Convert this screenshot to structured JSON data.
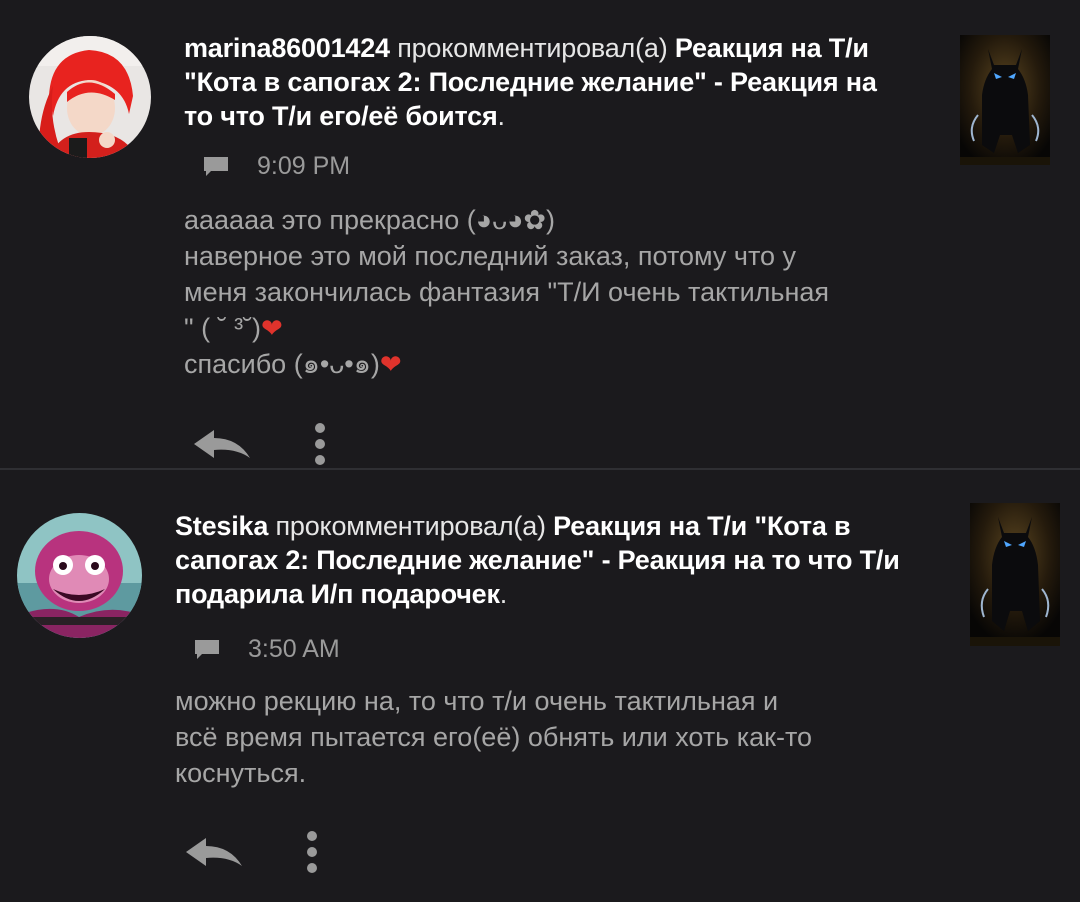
{
  "notifications": [
    {
      "username": "marina86001424",
      "verb": "прокомментировал(а)",
      "post_title": "Реакция на Т/и \"Кота в сапогах 2: Последние желание\" - Реакция на то что Т/и его/её боится",
      "post_title_end": ".",
      "time": "9:09 PM",
      "comment_lines": [
        "аааааа это прекрасно (◕ᴗ◕✿)",
        "наверное это мой последний заказ, потому что у",
        "меня закончилась фантазия \"Т/И очень тактильная",
        "\" ( ˘ ³˘)",
        "спасибо (๑•ᴗ•๑)"
      ],
      "heart_glyph": "❤"
    },
    {
      "username": "Stesika",
      "verb": "прокомментировал(а)",
      "post_title": "Реакция на Т/и \"Кота в сапогах 2: Последние желание\" - Реакция на то что Т/и подарила И/п подарочек",
      "post_title_end": ".",
      "time": "3:50 AM",
      "comment_lines": [
        "можно рекцию на, то что т/и очень тактильная и",
        "всё время пытается его(её) обнять или хоть как-то",
        "коснуться."
      ]
    }
  ],
  "icons": {
    "comment": "chat-bubble-icon",
    "reply": "reply-arrow-icon",
    "more": "more-vertical-icon"
  },
  "colors": {
    "background": "#1b1a1d",
    "text_primary": "#ffffff",
    "text_secondary": "#a6a6a6",
    "heart": "#e0332c",
    "divider": "#2f2f33"
  }
}
